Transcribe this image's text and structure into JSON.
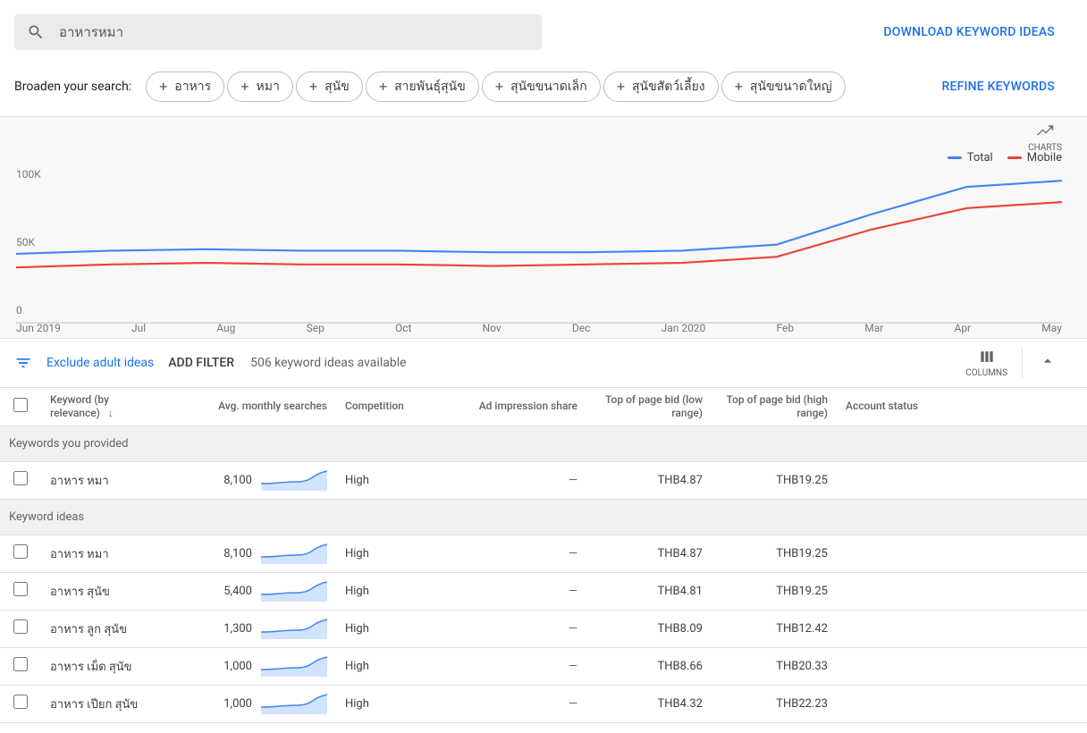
{
  "search": {
    "value": "อาหารหมา"
  },
  "download_label": "DOWNLOAD KEYWORD IDEAS",
  "broaden": {
    "label": "Broaden your search:",
    "chips": [
      "อาหาร",
      "หมา",
      "สุนัข",
      "สายพันธุ์สุนัข",
      "สุนัขขนาดเล็ก",
      "สุนัขสัตว์เลี้ยง",
      "สุนัขขนาดใหญ่"
    ]
  },
  "refine_label": "REFINE KEYWORDS",
  "chart_top": {
    "charts_label": "CHARTS"
  },
  "legend": {
    "total": "Total",
    "mobile": "Mobile"
  },
  "chart_data": {
    "type": "line",
    "ylabel": "",
    "ylim": [
      0,
      100000
    ],
    "yticks": [
      "100K",
      "50K",
      "0"
    ],
    "categories": [
      "Jun 2019",
      "Jul",
      "Aug",
      "Sep",
      "Oct",
      "Nov",
      "Dec",
      "Jan 2020",
      "Feb",
      "Mar",
      "Apr",
      "May"
    ],
    "series": [
      {
        "name": "Total",
        "color": "#4285f4",
        "values": [
          46000,
          48000,
          49000,
          48000,
          48000,
          47000,
          47000,
          48000,
          52000,
          72000,
          90000,
          94000
        ]
      },
      {
        "name": "Mobile",
        "color": "#ea4335",
        "values": [
          37000,
          39000,
          40000,
          39000,
          39000,
          38000,
          39000,
          40000,
          44000,
          62000,
          76000,
          80000
        ]
      }
    ]
  },
  "filterbar": {
    "exclude": "Exclude adult ideas",
    "add_filter": "ADD FILTER",
    "ideas_count": "506 keyword ideas available",
    "columns_label": "COLUMNS"
  },
  "columns": {
    "keyword": "Keyword (by relevance)",
    "avg": "Avg. monthly searches",
    "competition": "Competition",
    "ad_share": "Ad impression share",
    "bid_low": "Top of page bid (low range)",
    "bid_high": "Top of page bid (high range)",
    "account": "Account status"
  },
  "sections": {
    "provided_header": "Keywords you provided",
    "ideas_header": "Keyword ideas"
  },
  "rows_provided": [
    {
      "keyword": "อาหาร หมา",
      "avg": "8,100",
      "competition": "High",
      "ad_share": "—",
      "bid_low": "THB4.87",
      "bid_high": "THB19.25",
      "account": ""
    }
  ],
  "rows_ideas": [
    {
      "keyword": "อาหาร หมา",
      "avg": "8,100",
      "competition": "High",
      "ad_share": "—",
      "bid_low": "THB4.87",
      "bid_high": "THB19.25",
      "account": ""
    },
    {
      "keyword": "อาหาร สุนัข",
      "avg": "5,400",
      "competition": "High",
      "ad_share": "—",
      "bid_low": "THB4.81",
      "bid_high": "THB19.25",
      "account": ""
    },
    {
      "keyword": "อาหาร ลูก สุนัข",
      "avg": "1,300",
      "competition": "High",
      "ad_share": "—",
      "bid_low": "THB8.09",
      "bid_high": "THB12.42",
      "account": ""
    },
    {
      "keyword": "อาหาร เม็ด สุนัข",
      "avg": "1,000",
      "competition": "High",
      "ad_share": "—",
      "bid_low": "THB8.66",
      "bid_high": "THB20.33",
      "account": ""
    },
    {
      "keyword": "อาหาร เปียก สุนัข",
      "avg": "1,000",
      "competition": "High",
      "ad_share": "—",
      "bid_low": "THB4.32",
      "bid_high": "THB22.23",
      "account": ""
    }
  ]
}
